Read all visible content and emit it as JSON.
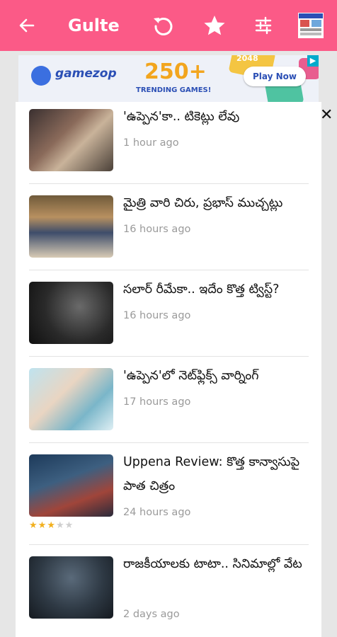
{
  "app": {
    "title": "Gulte"
  },
  "ad": {
    "brand": "gamezop",
    "headline": "250+",
    "subtext": "TRENDING GAMES!",
    "cta": "Play Now",
    "corner_badge": "2048"
  },
  "articles": [
    {
      "headline": "'ఉప్పెన'కా.. టికెట్లు లేవు",
      "time": "1 hour ago"
    },
    {
      "headline": "మైత్రి వారి చిరు, ప్రభాస్ ముచ్చట్లు",
      "time": "16 hours ago"
    },
    {
      "headline": "సలార్ రీమేకా.. ఇదేం కొత్త ట్విస్ట్?",
      "time": "16 hours ago"
    },
    {
      "headline": "'ఉప్పెన'లో నెట్‌ఫ్లిక్స్ వార్నింగ్",
      "time": "17 hours ago"
    },
    {
      "headline": "Uppena Review: కొత్త కాన్వాసుపై పాత చిత్రం",
      "time": "24 hours ago",
      "rating": 3,
      "rating_max": 5
    },
    {
      "headline": "రాజకీయాలకు టాటా.. సినిమాల్లో వేట",
      "time": "2 days ago"
    }
  ],
  "colors": {
    "toolbar": "#fb5a87",
    "background": "#e6e6e6",
    "star": "#f2b01e"
  },
  "icons": [
    "back-arrow-icon",
    "refresh-icon",
    "star-icon",
    "filter-icon",
    "news-thumbnail-icon",
    "ad-info-icon",
    "close-icon"
  ]
}
